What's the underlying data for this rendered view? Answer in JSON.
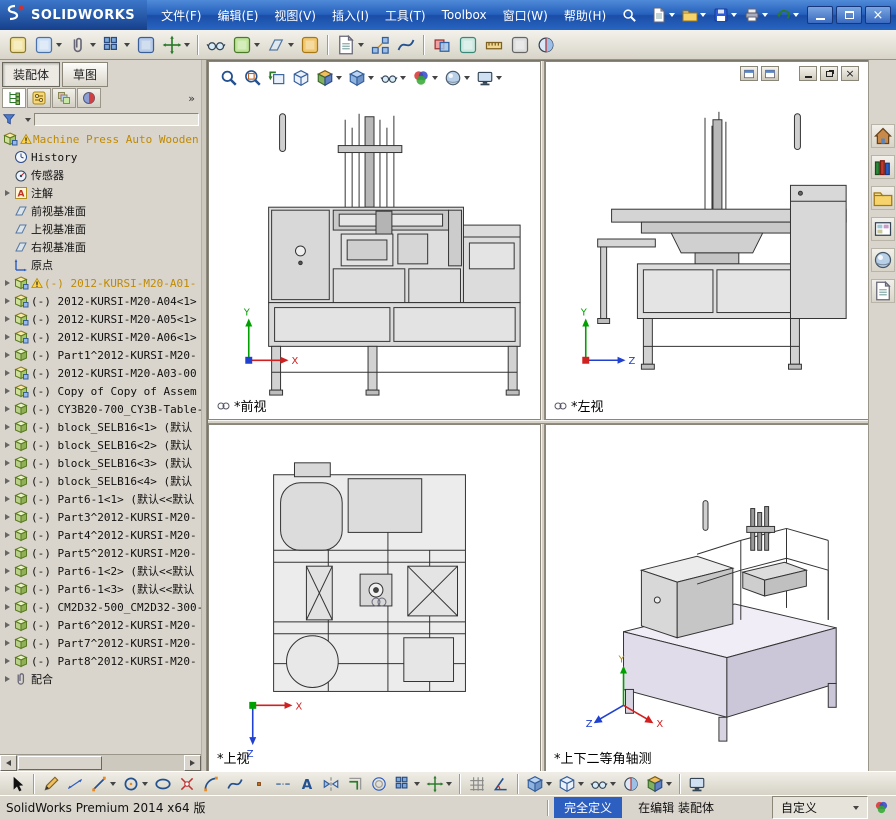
{
  "colors": {
    "titlebar_blue": "#2560bc",
    "status_selected_bg": "#2d5fc0",
    "warning_text": "#c08a00"
  },
  "titlebar": {
    "brand": "SOLIDWORKS",
    "menus": [
      {
        "name": "file",
        "label": "文件(F)"
      },
      {
        "name": "edit",
        "label": "编辑(E)"
      },
      {
        "name": "view",
        "label": "视图(V)"
      },
      {
        "name": "insert",
        "label": "插入(I)"
      },
      {
        "name": "tools",
        "label": "工具(T)"
      },
      {
        "name": "toolbox",
        "label": "Toolbox"
      },
      {
        "name": "window",
        "label": "窗口(W)"
      },
      {
        "name": "help",
        "label": "帮助(H)"
      }
    ],
    "quick_icons": [
      {
        "name": "new-document",
        "icon": "page",
        "caret": true
      },
      {
        "name": "open-document",
        "icon": "folder",
        "caret": true
      },
      {
        "name": "save",
        "icon": "floppy",
        "caret": true
      },
      {
        "name": "print",
        "icon": "printer",
        "caret": true
      },
      {
        "name": "undo",
        "icon": "undo",
        "caret": true
      }
    ],
    "window_buttons": [
      {
        "name": "minimize"
      },
      {
        "name": "maximize"
      },
      {
        "name": "close"
      }
    ]
  },
  "toolbar": {
    "items": [
      {
        "name": "edit-component",
        "icon": "generic",
        "c1": "#f2e3a0",
        "c2": "#8a7a30"
      },
      {
        "name": "insert-components",
        "icon": "generic",
        "c1": "#cfe0f5",
        "c2": "#4a72a8",
        "caret": true
      },
      {
        "name": "mate",
        "icon": "paperclip",
        "caret": true
      },
      {
        "name": "linear-component-pattern",
        "icon": "pattern",
        "caret": true
      },
      {
        "name": "smart-fasteners",
        "icon": "generic",
        "c1": "#b8cce8",
        "c2": "#3a5e98"
      },
      {
        "name": "move-component",
        "icon": "move",
        "caret": true
      },
      {
        "sep": true
      },
      {
        "name": "show-hidden-components",
        "icon": "glasses"
      },
      {
        "name": "assembly-features",
        "icon": "generic",
        "c1": "#bfe49a",
        "c2": "#4a7a2a",
        "caret": true
      },
      {
        "name": "reference-geometry",
        "icon": "plane",
        "caret": true
      },
      {
        "name": "new-motion-study",
        "icon": "generic",
        "c1": "#f0c870",
        "c2": "#a87818"
      },
      {
        "sep": true
      },
      {
        "name": "bill-of-materials",
        "icon": "page",
        "caret": true
      },
      {
        "name": "exploded-view",
        "icon": "exploded"
      },
      {
        "name": "explode-line-sketch",
        "icon": "spline"
      },
      {
        "sep": true
      },
      {
        "name": "interference-detection",
        "icon": "interfere"
      },
      {
        "name": "clearance-verification",
        "icon": "generic",
        "c1": "#cde8e0",
        "c2": "#3a8878"
      },
      {
        "name": "measure",
        "icon": "ruler"
      },
      {
        "name": "mass-properties",
        "icon": "generic",
        "c1": "#dedede",
        "c2": "#666666"
      },
      {
        "name": "section-properties",
        "icon": "section"
      }
    ]
  },
  "left_panel": {
    "tabs": [
      {
        "name": "assembly",
        "label": "装配体",
        "active": true
      },
      {
        "name": "sketch",
        "label": "草图",
        "active": false
      }
    ],
    "pane_tabs": [
      {
        "name": "featuremanager",
        "icon": "fm-tree"
      },
      {
        "name": "propertymanager",
        "icon": "prop"
      },
      {
        "name": "configurationmanager",
        "icon": "config"
      },
      {
        "name": "displaymanager",
        "icon": "sphere2"
      }
    ],
    "overflow_label": "»",
    "tree": [
      {
        "name": "assembly-root",
        "icon": "asm",
        "warn": true,
        "root": true,
        "label": "Machine Press Auto Wooden",
        "color": "#c08a00"
      },
      {
        "name": "history-folder",
        "icon": "clock",
        "label": "History"
      },
      {
        "name": "sensors-folder",
        "icon": "sensor",
        "label": "传感器"
      },
      {
        "name": "annotations-folder",
        "icon": "annA",
        "exp": true,
        "label": "注解"
      },
      {
        "name": "front-plane",
        "icon": "plane",
        "label": "前视基准面"
      },
      {
        "name": "top-plane",
        "icon": "plane",
        "label": "上视基准面"
      },
      {
        "name": "right-plane",
        "icon": "plane",
        "label": "右视基准面"
      },
      {
        "name": "origin",
        "icon": "origin",
        "label": "原点"
      },
      {
        "name": "component",
        "icon": "asm",
        "warn": true,
        "exp": true,
        "label": "(-) 2012-KURSI-M20-A01-",
        "color": "#c08a00"
      },
      {
        "name": "component",
        "icon": "asm",
        "exp": true,
        "label": "(-) 2012-KURSI-M20-A04<1>"
      },
      {
        "name": "component",
        "icon": "asm",
        "exp": true,
        "label": "(-) 2012-KURSI-M20-A05<1>"
      },
      {
        "name": "component",
        "icon": "asm",
        "exp": true,
        "label": "(-) 2012-KURSI-M20-A06<1>"
      },
      {
        "name": "component",
        "icon": "part",
        "exp": true,
        "label": "(-) Part1^2012-KURSI-M20-"
      },
      {
        "name": "component",
        "icon": "asm",
        "exp": true,
        "label": "(-) 2012-KURSI-M20-A03-00"
      },
      {
        "name": "component",
        "icon": "asm",
        "exp": true,
        "label": "(-) Copy of Copy of Assem"
      },
      {
        "name": "component",
        "icon": "part",
        "exp": true,
        "label": "(-) CY3B20-700_CY3B-Table-"
      },
      {
        "name": "component",
        "icon": "part",
        "exp": true,
        "label": "(-) block_SELB16<1> (默认"
      },
      {
        "name": "component",
        "icon": "part",
        "exp": true,
        "label": "(-) block_SELB16<2> (默认"
      },
      {
        "name": "component",
        "icon": "part",
        "exp": true,
        "label": "(-) block_SELB16<3> (默认"
      },
      {
        "name": "component",
        "icon": "part",
        "exp": true,
        "label": "(-) block_SELB16<4> (默认"
      },
      {
        "name": "component",
        "icon": "part",
        "exp": true,
        "label": "(-) Part6-1<1> (默认<<默认"
      },
      {
        "name": "component",
        "icon": "part",
        "exp": true,
        "label": "(-) Part3^2012-KURSI-M20-"
      },
      {
        "name": "component",
        "icon": "part",
        "exp": true,
        "label": "(-) Part4^2012-KURSI-M20-"
      },
      {
        "name": "component",
        "icon": "part",
        "exp": true,
        "label": "(-) Part5^2012-KURSI-M20-"
      },
      {
        "name": "component",
        "icon": "part",
        "exp": true,
        "label": "(-) Part6-1<2> (默认<<默认"
      },
      {
        "name": "component",
        "icon": "part",
        "exp": true,
        "label": "(-) Part6-1<3> (默认<<默认"
      },
      {
        "name": "component",
        "icon": "part",
        "exp": true,
        "label": "(-) CM2D32-500_CM2D32-300-"
      },
      {
        "name": "component",
        "icon": "part",
        "exp": true,
        "label": "(-) Part6^2012-KURSI-M20-"
      },
      {
        "name": "component",
        "icon": "part",
        "exp": true,
        "label": "(-) Part7^2012-KURSI-M20-"
      },
      {
        "name": "component",
        "icon": "part",
        "exp": true,
        "label": "(-) Part8^2012-KURSI-M20-"
      },
      {
        "name": "mates-folder",
        "icon": "paperclip",
        "exp": true,
        "label": "配合"
      }
    ]
  },
  "graphics": {
    "viewport_toolbar": [
      {
        "name": "zoom-to-fit",
        "icon": "magnifier"
      },
      {
        "name": "zoom-to-area",
        "icon": "magnifier-area"
      },
      {
        "name": "previous-view",
        "icon": "prevview"
      },
      {
        "name": "3d-drawing-view",
        "icon": "cube-wire"
      },
      {
        "name": "view-orientation",
        "icon": "cube-views",
        "caret": true
      },
      {
        "name": "display-style",
        "icon": "cube-shaded",
        "caret": true
      },
      {
        "name": "hide-show-items",
        "icon": "glasses",
        "caret": true
      },
      {
        "name": "edit-appearance",
        "icon": "colorwheel",
        "caret": true
      },
      {
        "name": "apply-scene",
        "icon": "sphere",
        "caret": true
      },
      {
        "name": "view-settings",
        "icon": "monitor",
        "caret": true
      }
    ],
    "doc_controls": [
      {
        "name": "doc-pane-left",
        "kind": "pane"
      },
      {
        "name": "doc-pane-right",
        "kind": "pane"
      },
      {
        "name": "doc-minimize",
        "kind": "min"
      },
      {
        "name": "doc-restore",
        "kind": "restore"
      },
      {
        "name": "doc-close",
        "kind": "close"
      }
    ],
    "viewports": {
      "front": {
        "label": "*前视"
      },
      "left": {
        "label": "*左视"
      },
      "top": {
        "label": "*上视"
      },
      "iso": {
        "label": "*上下二等角轴测"
      }
    }
  },
  "task_pane": [
    {
      "name": "solidworks-resources",
      "icon": "house"
    },
    {
      "name": "design-library",
      "icon": "books"
    },
    {
      "name": "file-explorer",
      "icon": "folder"
    },
    {
      "name": "view-palette",
      "icon": "palette"
    },
    {
      "name": "appearances-scenes",
      "icon": "sphere"
    },
    {
      "name": "custom-properties",
      "icon": "page"
    }
  ],
  "sketch_toolbar": [
    {
      "name": "select",
      "icon": "arrow"
    },
    {
      "sep": true
    },
    {
      "name": "sketch",
      "icon": "pencil"
    },
    {
      "name": "smart-dimension",
      "icon": "dimension"
    },
    {
      "name": "line",
      "icon": "line",
      "caret": true
    },
    {
      "name": "circle",
      "icon": "circle",
      "caret": true
    },
    {
      "name": "ellipse",
      "icon": "ellipse"
    },
    {
      "name": "trim-entities",
      "icon": "trim"
    },
    {
      "name": "tangent-arc",
      "icon": "arc"
    },
    {
      "name": "spline",
      "icon": "spline"
    },
    {
      "name": "point",
      "icon": "point"
    },
    {
      "name": "centerline",
      "icon": "centerline"
    },
    {
      "name": "text",
      "icon": "text"
    },
    {
      "name": "mirror-entities",
      "icon": "mirror"
    },
    {
      "name": "convert-entities",
      "icon": "convert"
    },
    {
      "name": "offset-entities",
      "icon": "offset"
    },
    {
      "name": "linear-sketch-pattern",
      "icon": "pattern",
      "caret": true
    },
    {
      "name": "move-entities",
      "icon": "move",
      "caret": true
    },
    {
      "sep": true
    },
    {
      "name": "grid-snap",
      "icon": "grid"
    },
    {
      "name": "angle-snap",
      "icon": "angle"
    },
    {
      "sep": true
    },
    {
      "name": "shaded-with-edges",
      "icon": "cube-shaded",
      "caret": true
    },
    {
      "name": "display-style",
      "icon": "cube-wire",
      "caret": true
    },
    {
      "name": "hide-show",
      "icon": "glasses",
      "caret": true
    },
    {
      "name": "section-view",
      "icon": "section"
    },
    {
      "name": "view-orientation",
      "icon": "cube-views",
      "caret": true
    },
    {
      "sep": true
    },
    {
      "name": "full-screen",
      "icon": "monitor"
    }
  ],
  "statusbar": {
    "app": "SolidWorks Premium 2014 x64 版",
    "define_state": "完全定义",
    "edit_state": "在编辑 装配体",
    "toolbar_preset": "自定义"
  }
}
